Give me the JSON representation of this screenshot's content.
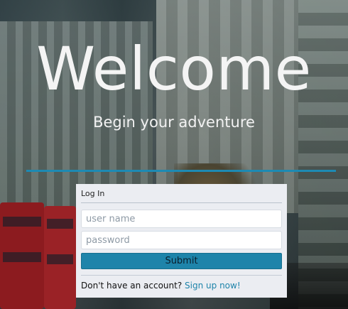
{
  "hero": {
    "title": "Welcome",
    "tagline": "Begin your adventure"
  },
  "login": {
    "panel_title": "Log In",
    "username_placeholder": "user name",
    "password_placeholder": "password",
    "submit_label": "Submit",
    "signup_prompt": "Don't have an account?",
    "signup_link": "Sign up now!"
  },
  "colors": {
    "accent": "#1e84aa",
    "panel_bg": "#ebedf2",
    "rule": "#1d8ab3"
  }
}
